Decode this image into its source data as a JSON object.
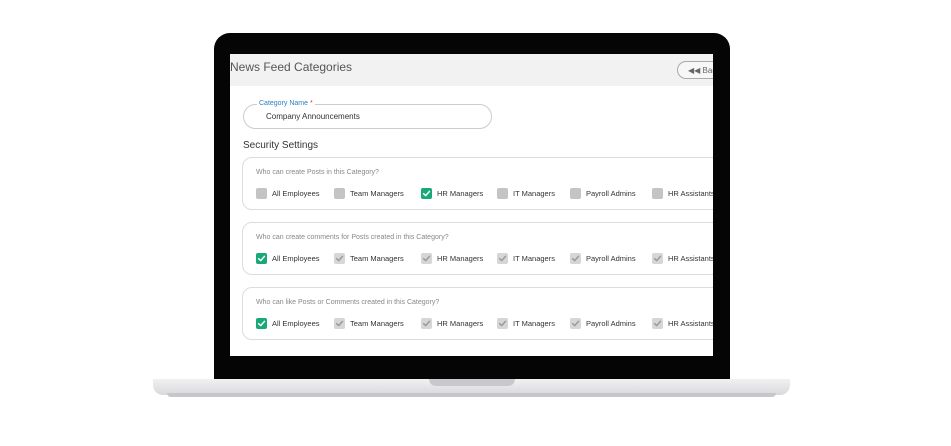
{
  "page": {
    "title": "News Feed Categories",
    "back_label": "Back"
  },
  "category_name": {
    "label": "Category Name",
    "required_mark": "*",
    "value": "Company Announcements"
  },
  "security": {
    "title": "Security Settings",
    "groups": [
      {
        "question": "Who can create Posts in this Category?",
        "options": [
          {
            "label": "All Employees",
            "state": "unchecked"
          },
          {
            "label": "Team Managers",
            "state": "unchecked"
          },
          {
            "label": "HR Managers",
            "state": "checked"
          },
          {
            "label": "IT Managers",
            "state": "unchecked"
          },
          {
            "label": "Payroll Admins",
            "state": "unchecked"
          },
          {
            "label": "HR Assistants",
            "state": "unchecked"
          }
        ]
      },
      {
        "question": "Who can create comments for Posts created in this Category?",
        "options": [
          {
            "label": "All Employees",
            "state": "checked"
          },
          {
            "label": "Team Managers",
            "state": "disabled"
          },
          {
            "label": "HR Managers",
            "state": "disabled"
          },
          {
            "label": "IT Managers",
            "state": "disabled"
          },
          {
            "label": "Payroll Admins",
            "state": "disabled"
          },
          {
            "label": "HR Assistants",
            "state": "disabled"
          }
        ]
      },
      {
        "question": "Who can like Posts or Comments created in this Category?",
        "options": [
          {
            "label": "All Employees",
            "state": "checked"
          },
          {
            "label": "Team Managers",
            "state": "disabled"
          },
          {
            "label": "HR Managers",
            "state": "disabled"
          },
          {
            "label": "IT Managers",
            "state": "disabled"
          },
          {
            "label": "Payroll Admins",
            "state": "disabled"
          },
          {
            "label": "HR Assistants",
            "state": "disabled"
          }
        ]
      }
    ]
  },
  "colors": {
    "checked": "#19a877",
    "unchecked": "#c4c4c4",
    "disabled": "#d6d6d6",
    "label_accent": "#2b7fc3",
    "required": "#e0303a"
  }
}
